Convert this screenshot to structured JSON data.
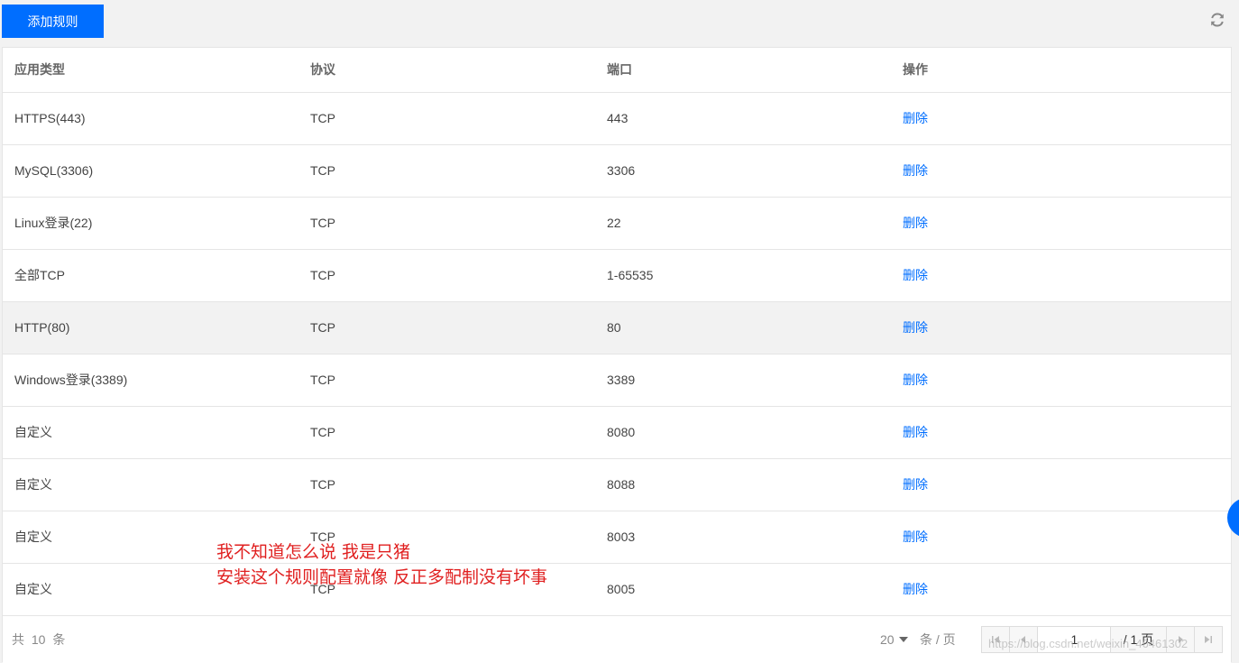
{
  "toolbar": {
    "add_rule_label": "添加规则",
    "refresh_icon": "refresh-icon"
  },
  "table": {
    "headers": [
      "应用类型",
      "协议",
      "端口",
      "操作"
    ],
    "rows": [
      {
        "type": "HTTPS(443)",
        "protocol": "TCP",
        "port": "443",
        "action": "删除"
      },
      {
        "type": "MySQL(3306)",
        "protocol": "TCP",
        "port": "3306",
        "action": "删除"
      },
      {
        "type": "Linux登录(22)",
        "protocol": "TCP",
        "port": "22",
        "action": "删除"
      },
      {
        "type": "全部TCP",
        "protocol": "TCP",
        "port": "1-65535",
        "action": "删除"
      },
      {
        "type": "HTTP(80)",
        "protocol": "TCP",
        "port": "80",
        "action": "删除"
      },
      {
        "type": "Windows登录(3389)",
        "protocol": "TCP",
        "port": "3389",
        "action": "删除"
      },
      {
        "type": "自定义",
        "protocol": "TCP",
        "port": "8080",
        "action": "删除"
      },
      {
        "type": "自定义",
        "protocol": "TCP",
        "port": "8088",
        "action": "删除"
      },
      {
        "type": "自定义",
        "protocol": "TCP",
        "port": "8003",
        "action": "删除"
      },
      {
        "type": "自定义",
        "protocol": "TCP",
        "port": "8005",
        "action": "删除"
      }
    ],
    "highlighted_row": 4
  },
  "footer": {
    "total_text": "共 10 条",
    "page_size": "20",
    "per_page_label": "条 / 页",
    "current_page": "1",
    "total_pages_text": "/ 1 页"
  },
  "annotation": {
    "line1": "我不知道怎么说 我是只猪",
    "line2": "安装这个规则配置就像 反正多配制没有坏事"
  },
  "watermark": "https://blog.csdn.net/weixin_46461302",
  "colors": {
    "accent": "#006eff",
    "annotation": "#e02020"
  }
}
